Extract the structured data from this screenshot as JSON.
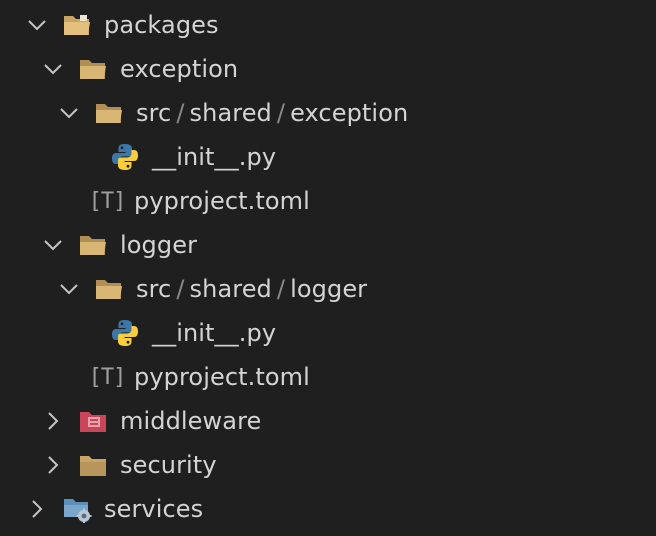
{
  "explorer": {
    "separator": "/",
    "rows": {
      "packages": {
        "label": "packages"
      },
      "exception": {
        "label": "exception"
      },
      "exception_src": {
        "seg1": "src",
        "seg2": "shared",
        "seg3": "exception"
      },
      "exception_init": {
        "label": "__init__.py"
      },
      "exception_toml": {
        "label": "pyproject.toml",
        "icon_text": "[T]"
      },
      "logger": {
        "label": "logger"
      },
      "logger_src": {
        "seg1": "src",
        "seg2": "shared",
        "seg3": "logger"
      },
      "logger_init": {
        "label": "__init__.py"
      },
      "logger_toml": {
        "label": "pyproject.toml",
        "icon_text": "[T]"
      },
      "middleware": {
        "label": "middleware"
      },
      "security": {
        "label": "security"
      },
      "services": {
        "label": "services"
      }
    }
  },
  "colors": {
    "background": "#1f1f1f",
    "text": "#d4d4d4",
    "chevron": "#c5c5c5",
    "folder": "#c9a565",
    "middleware_folder": "#c8455a",
    "services_folder": "#5b8fb9",
    "python_blue": "#3b77a8",
    "python_yellow": "#f7cf3e"
  }
}
